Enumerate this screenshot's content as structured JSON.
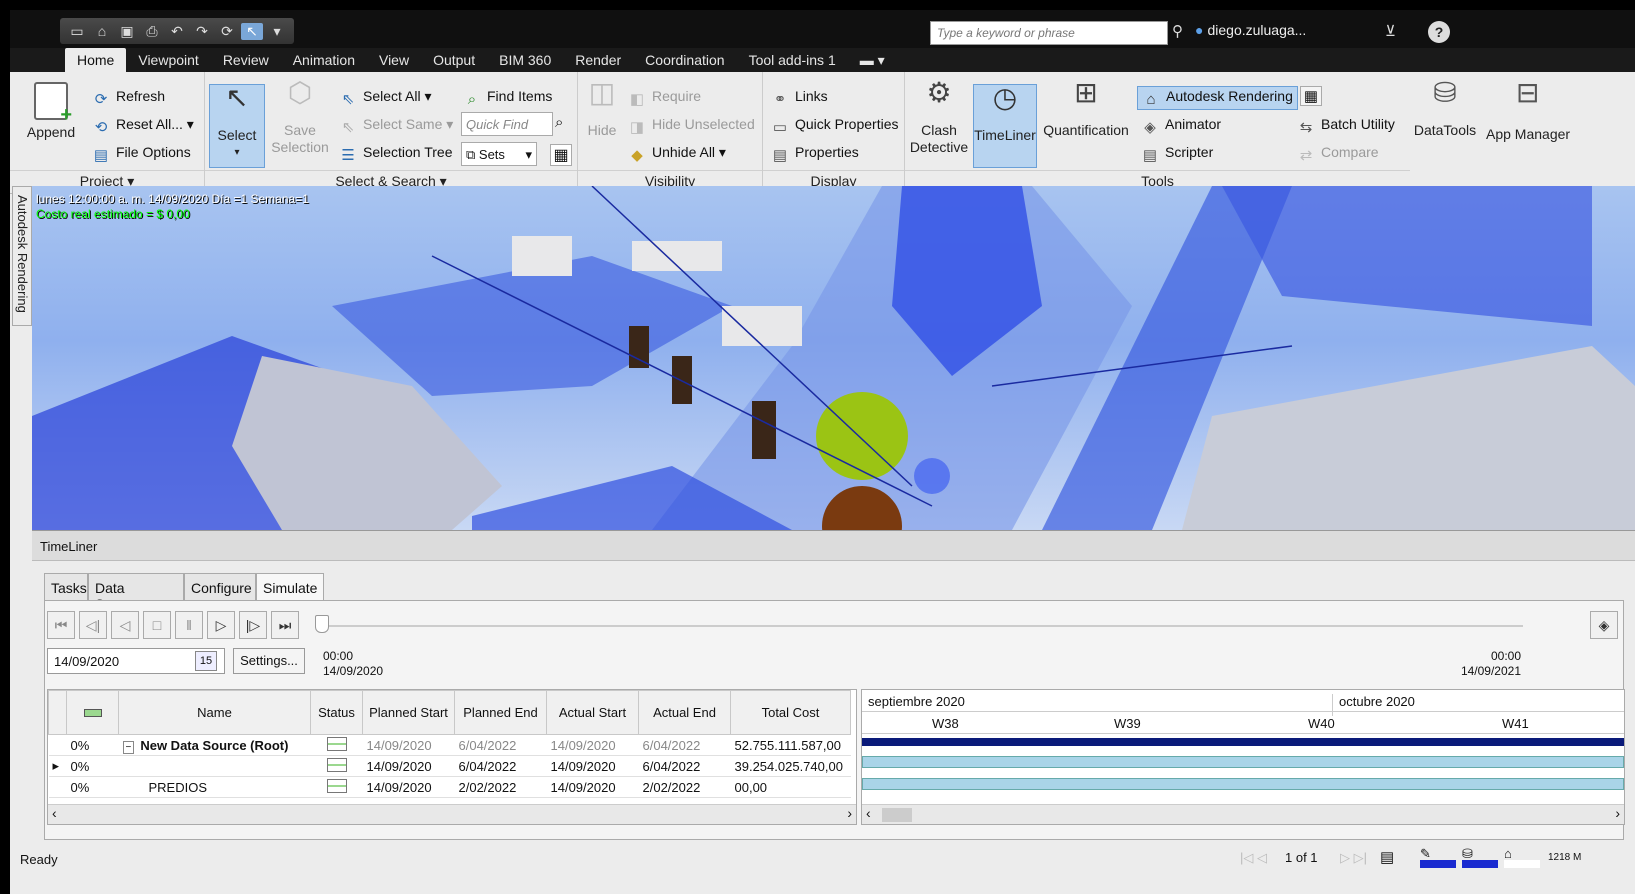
{
  "quick_access": {
    "icons": [
      "new-icon",
      "open-icon",
      "save-icon",
      "print-icon",
      "undo-icon",
      "redo-icon",
      "refresh-icon",
      "select-pointer-icon",
      "dropdown-icon"
    ]
  },
  "search": {
    "placeholder": "Type a keyword or phrase"
  },
  "user": {
    "name": "diego.zuluaga..."
  },
  "menu_tabs": [
    "Home",
    "Viewpoint",
    "Review",
    "Animation",
    "View",
    "Output",
    "BIM 360",
    "Render",
    "Coordination",
    "Tool add-ins 1"
  ],
  "ribbon": {
    "project": {
      "label": "Project",
      "append": "Append",
      "refresh": "Refresh",
      "reset_all": "Reset All...",
      "file_options": "File Options"
    },
    "select_search": {
      "label": "Select & Search",
      "select": "Select",
      "save_selection": "Save Selection",
      "select_all": "Select All",
      "select_same": "Select Same",
      "selection_tree": "Selection Tree",
      "find_items": "Find Items",
      "quick_find_placeholder": "Quick Find",
      "sets": "Sets"
    },
    "visibility": {
      "label": "Visibility",
      "hide": "Hide",
      "require": "Require",
      "hide_unselected": "Hide Unselected",
      "unhide_all": "Unhide All"
    },
    "display": {
      "label": "Display",
      "links": "Links",
      "quick_properties": "Quick Properties",
      "properties": "Properties"
    },
    "tools": {
      "label": "Tools",
      "clash_detective": "Clash Detective",
      "timeliner": "TimeLiner",
      "quantification": "Quantification",
      "autodesk_rendering": "Autodesk Rendering",
      "animator": "Animator",
      "scripter": "Scripter",
      "batch_utility": "Batch Utility",
      "compare": "Compare",
      "datatools": "DataTools",
      "app_manager": "App Manager"
    }
  },
  "viewport": {
    "side_label": "Autodesk Rendering",
    "hud_line1": "lunes 12:00:00 a. m. 14/09/2020 Día =1 Semana=1",
    "hud_line2": "Costo real estimado = $ 0,00"
  },
  "timeliner": {
    "title": "TimeLiner",
    "tabs": [
      "Tasks",
      "Data Sources",
      "Configure",
      "Simulate"
    ],
    "date_value": "14/09/2020",
    "cal_day": "15",
    "settings": "Settings...",
    "start_time": "00:00",
    "start_date": "14/09/2020",
    "end_time": "00:00",
    "end_date": "14/09/2021",
    "columns": [
      "Name",
      "Status",
      "Planned Start",
      "Planned End",
      "Actual Start",
      "Actual End",
      "Total Cost"
    ],
    "rows": [
      {
        "pct": "0%",
        "name": "New Data Source (Root)",
        "planned_start": "14/09/2020",
        "planned_end": "6/04/2022",
        "actual_start": "14/09/2020",
        "actual_end": "6/04/2022",
        "cost": "52.755.111.587,00"
      },
      {
        "pct": "0%",
        "name": "",
        "planned_start": "14/09/2020",
        "planned_end": "6/04/2022",
        "actual_start": "14/09/2020",
        "actual_end": "6/04/2022",
        "cost": "39.254.025.740,00"
      },
      {
        "pct": "0%",
        "name": "PREDIOS",
        "planned_start": "14/09/2020",
        "planned_end": "2/02/2022",
        "actual_start": "14/09/2020",
        "actual_end": "2/02/2022",
        "cost": "00,00"
      }
    ],
    "gantt": {
      "month1": "septiembre 2020",
      "month2": "octubre 2020",
      "weeks": [
        "W38",
        "W39",
        "W40",
        "W41"
      ]
    }
  },
  "statusbar": {
    "status": "Ready",
    "page": "1 of 1",
    "memory": "1218 M"
  }
}
